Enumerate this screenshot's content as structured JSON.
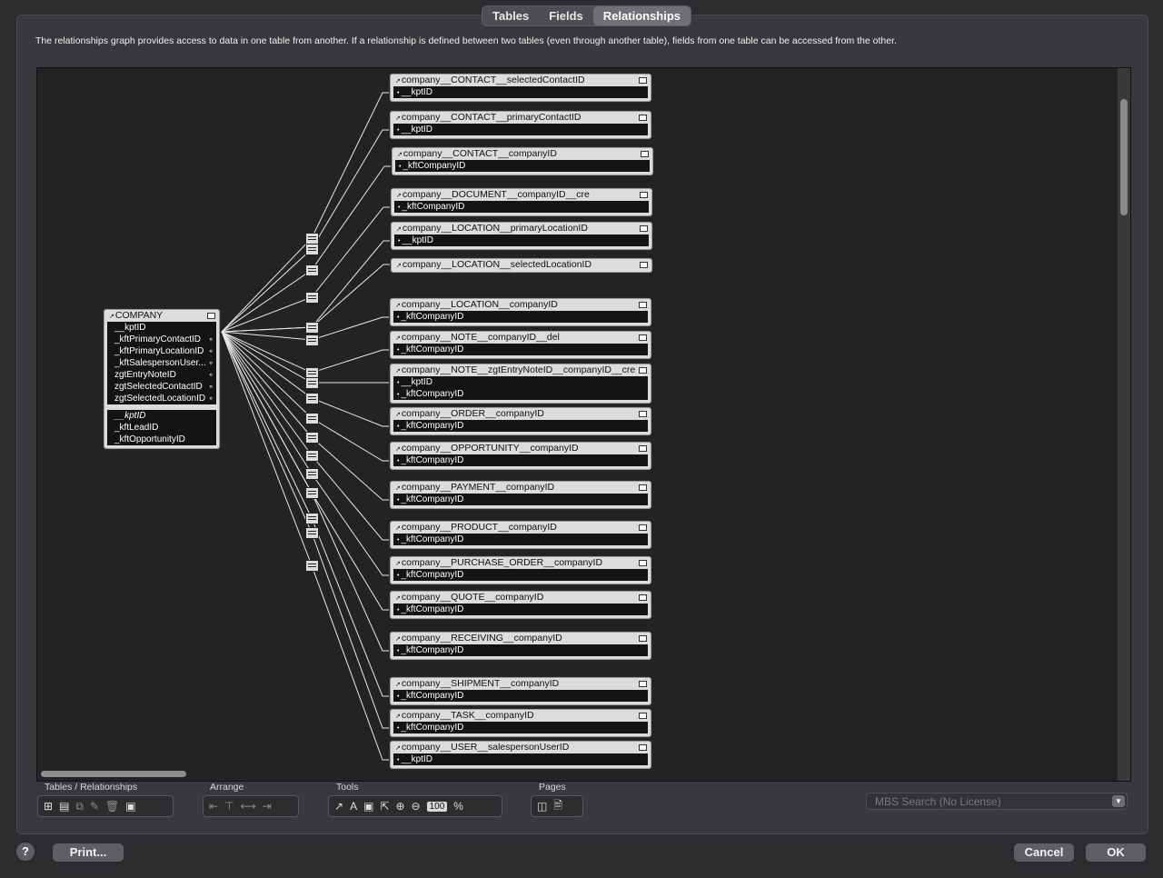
{
  "tabs": [
    {
      "label": "Tables",
      "active": false
    },
    {
      "label": "Fields",
      "active": false
    },
    {
      "label": "Relationships",
      "active": true
    }
  ],
  "description": "The relationships graph provides access to data in one table from another. If a relationship is defined between two tables (even through another table), fields from one table can be accessed from the other.",
  "company_table": {
    "title": "COMPANY",
    "fields": [
      "__kptID",
      "_kftPrimaryContactID",
      "_kftPrimaryLocationID",
      "_kftSalespersonUser...",
      "zgtEntryNoteID",
      "zgtSelectedContactID",
      "zgtSelectedLocationID"
    ],
    "extra_fields": [
      "__kptID",
      "_kftLeadID",
      "_kftOpportunityID"
    ]
  },
  "occurrences": [
    {
      "title": "company__CONTACT__selectedContactID",
      "fields": [
        "__kptID"
      ]
    },
    {
      "title": "company__CONTACT__primaryContactID",
      "fields": [
        "__kptID"
      ]
    },
    {
      "title": "company__CONTACT__companyID",
      "fields": [
        "_kftCompanyID"
      ]
    },
    {
      "title": "company__DOCUMENT__companyID__cre",
      "fields": [
        "_kftCompanyID"
      ]
    },
    {
      "title": "company__LOCATION__primaryLocationID",
      "fields": [
        "__kptID"
      ]
    },
    {
      "title": "company__LOCATION__selectedLocationID",
      "fields": []
    },
    {
      "title": "company__LOCATION__companyID",
      "fields": [
        "_kftCompanyID"
      ]
    },
    {
      "title": "company__NOTE__companyID__del",
      "fields": [
        "_kftCompanyID"
      ]
    },
    {
      "title": "company__NOTE__zgtEntryNoteID__companyID__cre",
      "fields": [
        "__kptID",
        "_kftCompanyID"
      ]
    },
    {
      "title": "company__ORDER__companyID",
      "fields": [
        "_kftCompanyID"
      ]
    },
    {
      "title": "company__OPPORTUNITY__companyID",
      "fields": [
        "_kftCompanyID"
      ]
    },
    {
      "title": "company__PAYMENT__companyID",
      "fields": [
        "_kftCompanyID"
      ]
    },
    {
      "title": "company__PRODUCT__companyID",
      "fields": [
        "_kftCompanyID"
      ]
    },
    {
      "title": "company__PURCHASE_ORDER__companyID",
      "fields": [
        "_kftCompanyID"
      ]
    },
    {
      "title": "company__QUOTE__companyID",
      "fields": [
        "_kftCompanyID"
      ]
    },
    {
      "title": "company__RECEIVING__companyID",
      "fields": [
        "_kftCompanyID"
      ]
    },
    {
      "title": "company__SHIPMENT__companyID",
      "fields": [
        "_kftCompanyID"
      ]
    },
    {
      "title": "company__TASK__companyID",
      "fields": [
        "_kftCompanyID"
      ]
    },
    {
      "title": "company__USER__salespersonUserID",
      "fields": [
        "__kptID"
      ]
    }
  ],
  "toolbar": {
    "tables_label": "Tables / Relationships",
    "arrange_label": "Arrange",
    "tools_label": "Tools",
    "pages_label": "Pages",
    "zoom_value": "100",
    "zoom_unit": "%"
  },
  "mbs_search": "MBS Search (No License)",
  "buttons": {
    "help": "?",
    "print": "Print...",
    "cancel": "Cancel",
    "ok": "OK"
  }
}
